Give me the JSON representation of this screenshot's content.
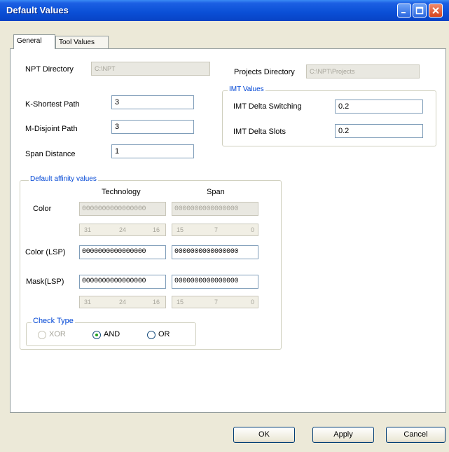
{
  "window": {
    "title": "Default Values",
    "controls": [
      "minimize-icon",
      "maximize-icon",
      "close-icon"
    ]
  },
  "tabs": [
    {
      "label": "General",
      "active": true
    },
    {
      "label": "Tool Values",
      "active": false
    }
  ],
  "npt_directory": {
    "label": "NPT Directory",
    "value": "C:\\NPT"
  },
  "projects_directory": {
    "label": "Projects Directory",
    "value": "C:\\NPT\\Projects"
  },
  "k_shortest_path": {
    "label": "K-Shortest Path",
    "value": "3"
  },
  "m_disjoint_path": {
    "label": "M-Disjoint Path",
    "value": "3"
  },
  "span_distance": {
    "label": "Span Distance",
    "value": "1"
  },
  "imt_values": {
    "legend": "IMT Values",
    "delta_switching": {
      "label": "IMT Delta Switching",
      "value": "0.2"
    },
    "delta_slots": {
      "label": "IMT Delta Slots",
      "value": "0.2"
    }
  },
  "affinity": {
    "legend": "Default affinity values",
    "col_technology": "Technology",
    "col_span": "Span",
    "color": {
      "label": "Color",
      "technology": "0000000000000000",
      "span": "0000000000000000"
    },
    "color_bits": {
      "technology": [
        "31",
        "24",
        "16"
      ],
      "span": [
        "15",
        "7",
        "0"
      ]
    },
    "color_lsp": {
      "label": "Color (LSP)",
      "technology": "0000000000000000",
      "span": "0000000000000000"
    },
    "mask_lsp": {
      "label": "Mask(LSP)",
      "technology": "0000000000000000",
      "span": "0000000000000000"
    },
    "mask_bits": {
      "technology": [
        "31",
        "24",
        "16"
      ],
      "span": [
        "15",
        "7",
        "0"
      ]
    },
    "check_type": {
      "legend": "Check Type",
      "options": [
        {
          "label": "XOR",
          "selected": false,
          "enabled": false
        },
        {
          "label": "AND",
          "selected": true,
          "enabled": true
        },
        {
          "label": "OR",
          "selected": false,
          "enabled": true
        }
      ]
    }
  },
  "buttons": {
    "ok": "OK",
    "apply": "Apply",
    "cancel": "Cancel"
  }
}
